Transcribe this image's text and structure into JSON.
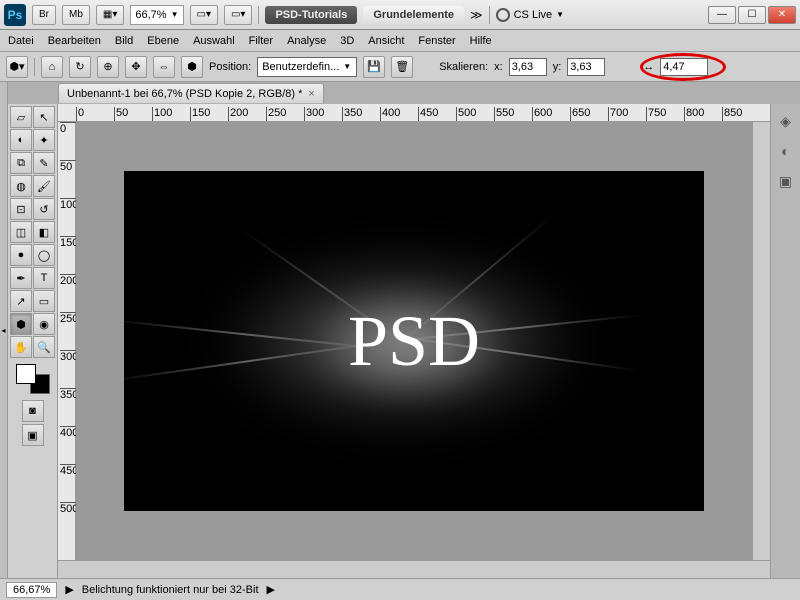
{
  "titlebar": {
    "br": "Br",
    "mb": "Mb",
    "zoom": "66,7%",
    "tab1": "PSD-Tutorials",
    "tab2": "Grundelemente",
    "cslive": "CS Live"
  },
  "menu": [
    "Datei",
    "Bearbeiten",
    "Bild",
    "Ebene",
    "Auswahl",
    "Filter",
    "Analyse",
    "3D",
    "Ansicht",
    "Fenster",
    "Hilfe"
  ],
  "opt": {
    "position_label": "Position:",
    "position_value": "Benutzerdefin...",
    "scale_label": "Skalieren:",
    "x_label": "x:",
    "x_val": "3,63",
    "y_label": "y:",
    "y_val": "3,63",
    "extra_val": "4,47"
  },
  "doc": {
    "title": "Unbenannt-1 bei 66,7% (PSD Kopie 2, RGB/8) *"
  },
  "ruler_h": [
    0,
    50,
    100,
    150,
    200,
    250,
    300,
    350,
    400,
    450,
    500,
    550,
    600,
    650,
    700,
    750,
    800,
    850
  ],
  "ruler_v": [
    0,
    50,
    100,
    150,
    200,
    250,
    300,
    350,
    400,
    450,
    500
  ],
  "canvas": {
    "text": "PSD"
  },
  "status": {
    "zoom": "66,67%",
    "msg": "Belichtung funktioniert nur bei 32-Bit"
  }
}
